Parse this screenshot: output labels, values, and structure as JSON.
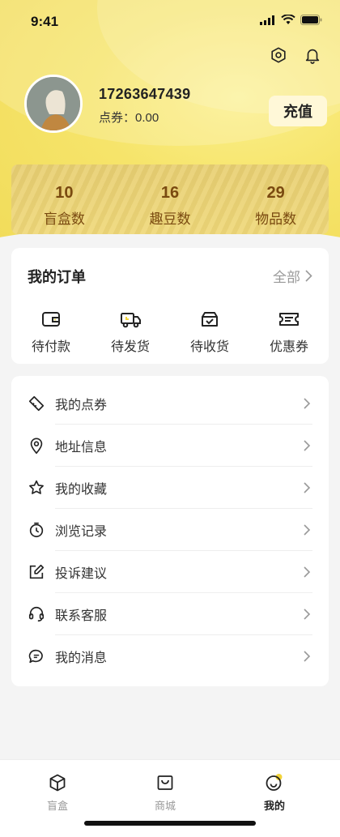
{
  "status_bar": {
    "time": "9:41"
  },
  "profile": {
    "phone": "17263647439",
    "points_label": "点券：",
    "points_value": "0.00",
    "recharge_label": "充值"
  },
  "stats": [
    {
      "value": "10",
      "label": "盲盒数"
    },
    {
      "value": "16",
      "label": "趣豆数"
    },
    {
      "value": "29",
      "label": "物品数"
    }
  ],
  "orders": {
    "title": "我的订单",
    "all_label": "全部",
    "items": [
      {
        "label": "待付款",
        "icon": "wallet-icon"
      },
      {
        "label": "待发货",
        "icon": "truck-icon"
      },
      {
        "label": "待收货",
        "icon": "box-check-icon"
      },
      {
        "label": "优惠券",
        "icon": "coupon-icon"
      }
    ]
  },
  "menu": [
    {
      "label": "我的点券",
      "icon": "ticket-icon"
    },
    {
      "label": "地址信息",
      "icon": "location-pin-icon"
    },
    {
      "label": "我的收藏",
      "icon": "star-icon"
    },
    {
      "label": "浏览记录",
      "icon": "history-clock-icon"
    },
    {
      "label": "投诉建议",
      "icon": "edit-square-icon"
    },
    {
      "label": "联系客服",
      "icon": "headset-icon"
    },
    {
      "label": "我的消息",
      "icon": "chat-bubble-icon"
    }
  ],
  "tabbar": {
    "tabs": [
      {
        "label": "盲盒",
        "icon": "cube-icon",
        "active": false
      },
      {
        "label": "商城",
        "icon": "shopping-bag-icon",
        "active": false
      },
      {
        "label": "我的",
        "icon": "smiley-icon",
        "active": true
      }
    ]
  },
  "colors": {
    "hero_yellow": "#f6e46a",
    "stat_brown": "#7a4a10",
    "accent_yellow": "#f2d43a"
  }
}
